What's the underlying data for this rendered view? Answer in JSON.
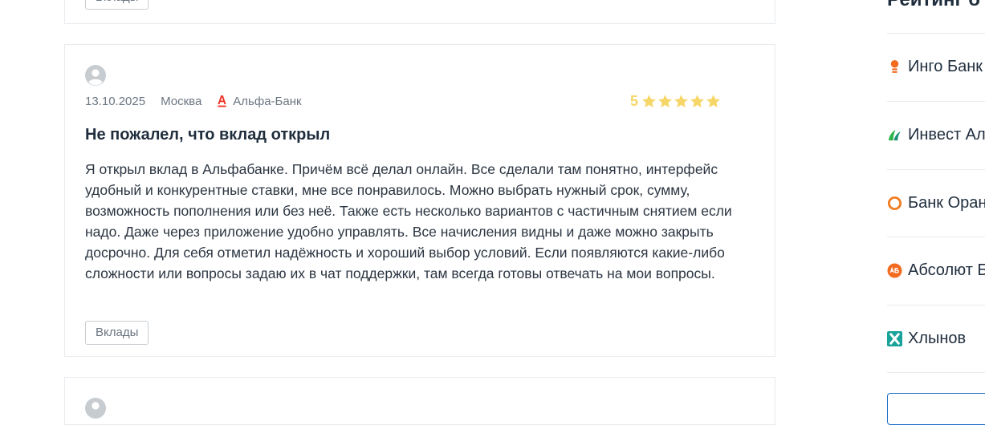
{
  "top_card": {
    "tag": "Вклады"
  },
  "review": {
    "date": "13.10.2025",
    "city": "Москва",
    "bank": "Альфа-Банк",
    "rating": "5",
    "stars": 5,
    "title": "Не пожалел, что вклад открыл",
    "text": "Я открыл вклад в Альфабанке. Причём всё делал онлайн. Все сделали там понятно, интерфейс удобный и конкурентные ставки, мне все понравилось. Можно выбрать нужный срок, сумму, возможность пополнения или без неё. Также есть несколько вариантов с частичным снятием если надо. Даже через приложение удобно управлять. Все начисления видны и даже можно закрыть досрочно. Для себя отметил надёжность и хороший выбор условий. Если появляются какие-либо сложности или вопросы задаю их в чат поддержки, там всегда готовы отвечать на мои вопросы.",
    "tag": "Вклады"
  },
  "sidebar": {
    "heading": "Рейтинг б",
    "items": [
      {
        "label": "Инго Банк",
        "icon": "ingo-bank-logo-icon",
        "color": "#f26d21"
      },
      {
        "label": "Инвест Ал",
        "icon": "invest-al-logo-icon",
        "color": "#2db34a"
      },
      {
        "label": "Банк Оран",
        "icon": "bank-oranzhevyi-logo-icon",
        "color": "#f07d22"
      },
      {
        "label": "Абсолют Б",
        "icon": "absolut-bank-logo-icon",
        "color": "#f26b21"
      },
      {
        "label": "Хлынов",
        "icon": "khlynov-logo-icon",
        "color": "#1aa39a"
      }
    ]
  },
  "colors": {
    "star": "#f7d668",
    "alfa_red": "#ef3124",
    "meta_text": "#6b7682",
    "sidebar_button_border": "#1e6fc6"
  }
}
